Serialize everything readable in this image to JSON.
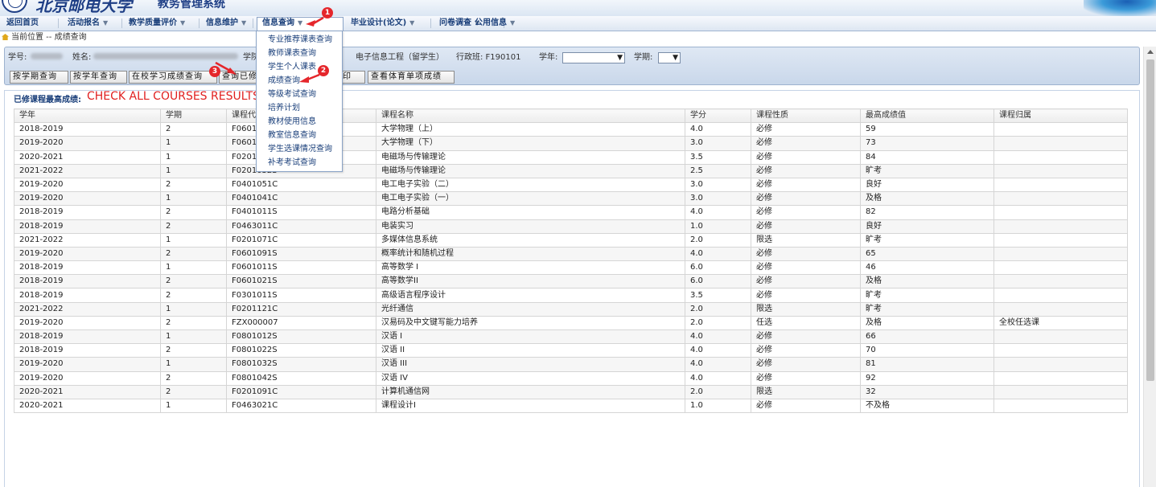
{
  "header": {
    "title": "北京邮电大学",
    "subtitle": "教务管理系统"
  },
  "menu": [
    {
      "label": "返回首页",
      "caret": ""
    },
    {
      "label": "活动报名",
      "caret": "▼"
    },
    {
      "label": "教学质量评价",
      "caret": "▼"
    },
    {
      "label": "信息维护",
      "caret": "▼"
    },
    {
      "label": "信息查询",
      "caret": "▼"
    },
    {
      "label": "毕业设计(论文)",
      "caret": "▼"
    },
    {
      "label": "问卷调查",
      "caret": "▼"
    },
    {
      "label": "公用信息",
      "caret": "▼"
    }
  ],
  "breadcrumb": {
    "label": "当前位置 -- 成绩查询"
  },
  "dropdown": {
    "items": [
      "专业推荐课表查询",
      "教师课表查询",
      "学生个人课表",
      "成绩查询",
      "等级考试查询",
      "培养计划",
      "教材使用信息",
      "教室信息查询",
      "学生选课情况查询",
      "补考考试查询"
    ]
  },
  "student": {
    "id_label": "学号:",
    "name_label": "姓名:",
    "college_label": "学院",
    "major": "电子信息工程（留学生）",
    "class_label": "行政班: F190101",
    "year_label": "学年:",
    "term_label": "学期:"
  },
  "buttons": [
    "按学期查询",
    "按学年查询",
    "在校学习成绩查询",
    "查询已修课程最高成绩",
    "打印",
    "查看体育单项成绩"
  ],
  "buttons_visible": [
    "按学期查询",
    "按学年查询",
    "在校学习成绩查询",
    "查询已修",
    "印",
    "查看体育单项成绩"
  ],
  "section_title": "已修课程最高成绩:",
  "annotation": "CHECK ALL COURSES RESULTS",
  "markers": [
    "1",
    "2",
    "3"
  ],
  "table": {
    "headers": [
      "学年",
      "学期",
      "课程代码",
      "课程名称",
      "学分",
      "课程性质",
      "最高成绩值",
      "课程归属"
    ],
    "rows": [
      [
        "2018-2019",
        "2",
        "F0601",
        "大学物理（上）",
        "4.0",
        "必修",
        "59",
        ""
      ],
      [
        "2019-2020",
        "1",
        "F0601",
        "大学物理（下）",
        "3.0",
        "必修",
        "73",
        ""
      ],
      [
        "2020-2021",
        "1",
        "F0201",
        "电磁场与传输理论",
        "3.5",
        "必修",
        "84",
        ""
      ],
      [
        "2021-2022",
        "1",
        "F0201052S",
        "电磁场与传输理论",
        "2.5",
        "必修",
        "旷考",
        ""
      ],
      [
        "2019-2020",
        "2",
        "F0401051C",
        "电工电子实验（二）",
        "3.0",
        "必修",
        "良好",
        ""
      ],
      [
        "2019-2020",
        "1",
        "F0401041C",
        "电工电子实验（一）",
        "3.0",
        "必修",
        "及格",
        ""
      ],
      [
        "2018-2019",
        "2",
        "F0401011S",
        "电路分析基础",
        "4.0",
        "必修",
        "82",
        ""
      ],
      [
        "2018-2019",
        "2",
        "F0463011C",
        "电装实习",
        "1.0",
        "必修",
        "良好",
        ""
      ],
      [
        "2021-2022",
        "1",
        "F0201071C",
        "多媒体信息系统",
        "2.0",
        "限选",
        "旷考",
        ""
      ],
      [
        "2019-2020",
        "2",
        "F0601091S",
        "概率统计和随机过程",
        "4.0",
        "必修",
        "65",
        ""
      ],
      [
        "2018-2019",
        "1",
        "F0601011S",
        "高等数学 I",
        "6.0",
        "必修",
        "46",
        ""
      ],
      [
        "2018-2019",
        "2",
        "F0601021S",
        "高等数学II",
        "6.0",
        "必修",
        "及格",
        ""
      ],
      [
        "2018-2019",
        "2",
        "F0301011S",
        "高级语言程序设计",
        "3.5",
        "必修",
        "旷考",
        ""
      ],
      [
        "2021-2022",
        "1",
        "F0201121C",
        "光纤通信",
        "2.0",
        "限选",
        "旷考",
        ""
      ],
      [
        "2019-2020",
        "2",
        "FZX000007",
        "汉易码及中文键写能力培养",
        "2.0",
        "任选",
        "及格",
        "全校任选课"
      ],
      [
        "2018-2019",
        "1",
        "F0801012S",
        "汉语 I",
        "4.0",
        "必修",
        "66",
        ""
      ],
      [
        "2018-2019",
        "2",
        "F0801022S",
        "汉语 II",
        "4.0",
        "必修",
        "70",
        ""
      ],
      [
        "2019-2020",
        "1",
        "F0801032S",
        "汉语 III",
        "4.0",
        "必修",
        "81",
        ""
      ],
      [
        "2019-2020",
        "2",
        "F0801042S",
        "汉语 IV",
        "4.0",
        "必修",
        "92",
        ""
      ],
      [
        "2020-2021",
        "2",
        "F0201091C",
        "计算机通信网",
        "2.0",
        "限选",
        "32",
        ""
      ],
      [
        "2020-2021",
        "1",
        "F0463021C",
        "课程设计I",
        "1.0",
        "必修",
        "不及格",
        ""
      ]
    ]
  }
}
